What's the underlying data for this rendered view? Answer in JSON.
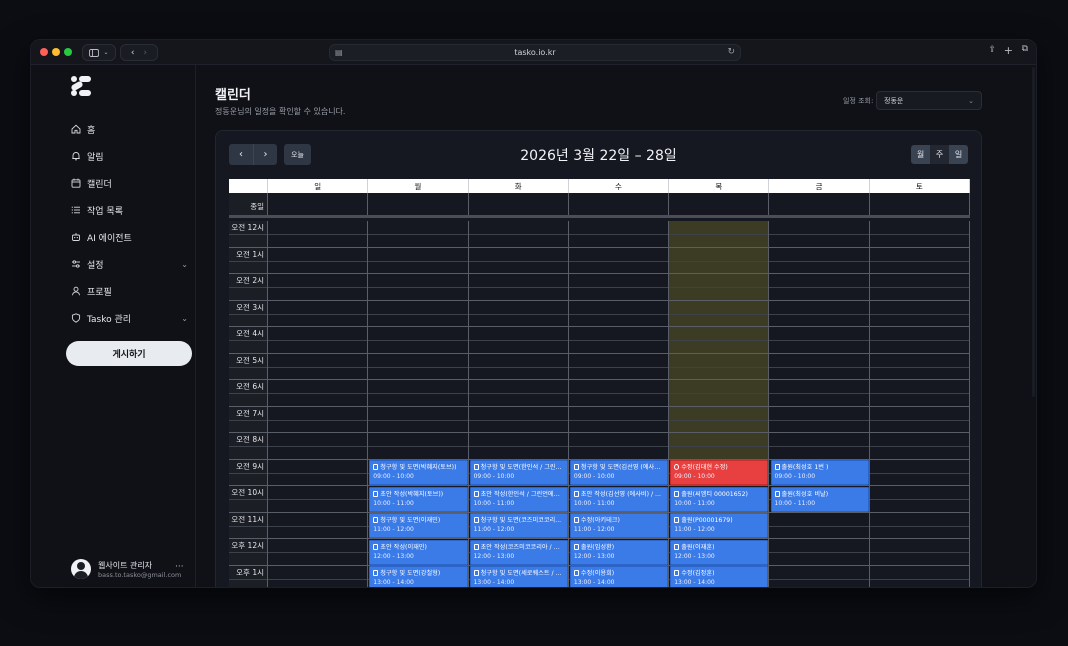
{
  "browser": {
    "url": "tasko.io.kr"
  },
  "sidebar": {
    "items": [
      {
        "label": "홈",
        "icon": "home-icon"
      },
      {
        "label": "알림",
        "icon": "bell-icon"
      },
      {
        "label": "캘린더",
        "icon": "calendar-icon"
      },
      {
        "label": "작업 목록",
        "icon": "list-icon"
      },
      {
        "label": "AI 에이전트",
        "icon": "robot-icon"
      },
      {
        "label": "설정",
        "icon": "sliders-icon",
        "has_chevron": true
      },
      {
        "label": "프로필",
        "icon": "user-icon"
      },
      {
        "label": "Tasko 관리",
        "icon": "shield-icon",
        "has_chevron": true
      }
    ],
    "publish_button": "게시하기",
    "user": {
      "name": "웹사이트 관리자",
      "email": "bass.to.tasko@gmail.com"
    }
  },
  "header": {
    "title": "캘린더",
    "subtitle": "정동운님의 일정을 확인할 수 있습니다.",
    "filter_label": "일정 조회:",
    "filter_value": "정동운"
  },
  "calendar": {
    "today_label": "오늘",
    "range_title": "2026년 3월 22일 – 28일",
    "views": [
      "월",
      "주",
      "일"
    ],
    "active_view": "주",
    "allday_label": "종일",
    "days": [
      "일",
      "월",
      "화",
      "수",
      "목",
      "금",
      "토"
    ],
    "today_index": 4,
    "hours": [
      "오전 12시",
      "오전 1시",
      "오전 2시",
      "오전 3시",
      "오전 4시",
      "오전 5시",
      "오전 6시",
      "오전 7시",
      "오전 8시",
      "오전 9시",
      "오전 10시",
      "오전 11시",
      "오후 12시",
      "오후 1시"
    ],
    "events": [
      {
        "day": 1,
        "hour": 9,
        "title": "청구항 및 도면(박혜지(토브))",
        "time": "09:00 - 10:00",
        "color": "blue"
      },
      {
        "day": 1,
        "hour": 10,
        "title": "초안 작성(박혜지(토브))",
        "time": "10:00 - 11:00",
        "color": "blue"
      },
      {
        "day": 1,
        "hour": 11,
        "title": "청구항 및 도면(이재민)",
        "time": "11:00 - 12:00",
        "color": "blue"
      },
      {
        "day": 1,
        "hour": 12,
        "title": "초안 작성(이재민)",
        "time": "12:00 - 13:00",
        "color": "blue"
      },
      {
        "day": 1,
        "hour": 13,
        "title": "청구항 및 도면(강철형)",
        "time": "13:00 - 14:00",
        "color": "blue"
      },
      {
        "day": 2,
        "hour": 9,
        "title": "청구항 및 도면(한인석 / 그린...",
        "time": "09:00 - 10:00",
        "color": "blue"
      },
      {
        "day": 2,
        "hour": 10,
        "title": "초안 작성(한인석 / 그린언에너...",
        "time": "10:00 - 11:00",
        "color": "blue"
      },
      {
        "day": 2,
        "hour": 11,
        "title": "청구항 및 도면(코즈미코코리...",
        "time": "11:00 - 12:00",
        "color": "blue"
      },
      {
        "day": 2,
        "hour": 12,
        "title": "초안 작성(코즈미코코리아 / 김...",
        "time": "12:00 - 13:00",
        "color": "blue"
      },
      {
        "day": 2,
        "hour": 13,
        "title": "청구항 및 도면(세로퀘스트 / ...",
        "time": "13:00 - 14:00",
        "color": "blue"
      },
      {
        "day": 3,
        "hour": 9,
        "title": "청구항 및 도면(김선영 (에사비...",
        "time": "09:00 - 10:00",
        "color": "blue"
      },
      {
        "day": 3,
        "hour": 10,
        "title": "초안 작성(김선영 (에사비) / ...",
        "time": "10:00 - 11:00",
        "color": "blue"
      },
      {
        "day": 3,
        "hour": 11,
        "title": "수정(아키테크)",
        "time": "11:00 - 12:00",
        "color": "blue"
      },
      {
        "day": 3,
        "hour": 12,
        "title": "출원(임성환)",
        "time": "12:00 - 13:00",
        "color": "blue"
      },
      {
        "day": 3,
        "hour": 13,
        "title": "수정(이용희)",
        "time": "13:00 - 14:00",
        "color": "blue"
      },
      {
        "day": 4,
        "hour": 9,
        "title": "수정(김대현 수정)",
        "time": "09:00 - 10:00",
        "color": "red"
      },
      {
        "day": 4,
        "hour": 10,
        "title": "출원(씨엠티 00001652)",
        "time": "10:00 - 11:00",
        "color": "blue"
      },
      {
        "day": 4,
        "hour": 11,
        "title": "출원(P00001679)",
        "time": "11:00 - 12:00",
        "color": "blue"
      },
      {
        "day": 4,
        "hour": 12,
        "title": "출원(이재훈)",
        "time": "12:00 - 13:00",
        "color": "blue"
      },
      {
        "day": 4,
        "hour": 13,
        "title": "수정(김정훈)",
        "time": "13:00 - 14:00",
        "color": "blue"
      },
      {
        "day": 5,
        "hour": 9,
        "title": "출원(최성호 1번 )",
        "time": "09:00 - 10:00",
        "color": "blue"
      },
      {
        "day": 5,
        "hour": 10,
        "title": "출원(최성호 비날)",
        "time": "10:00 - 11:00",
        "color": "blue"
      }
    ]
  },
  "colors": {
    "event_blue": "#3b7be8",
    "event_red": "#e84040",
    "today_highlight": "#3c3b24"
  }
}
